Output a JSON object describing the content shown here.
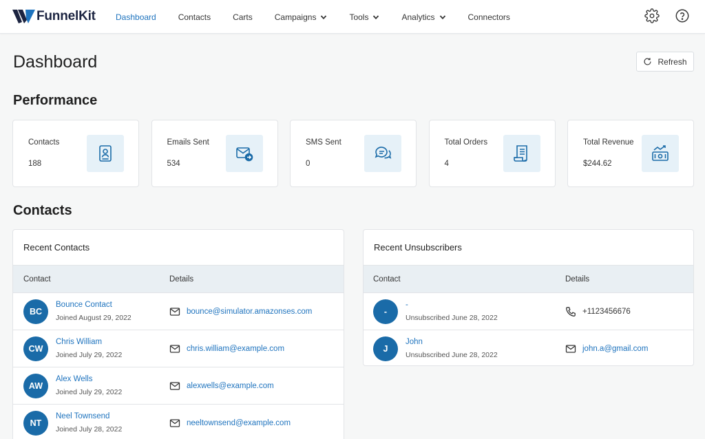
{
  "brand": {
    "name": "FunnelKit",
    "accent": "#1e73be"
  },
  "nav": {
    "items": [
      {
        "label": "Dashboard",
        "active": true,
        "dropdown": false
      },
      {
        "label": "Contacts",
        "active": false,
        "dropdown": false
      },
      {
        "label": "Carts",
        "active": false,
        "dropdown": false
      },
      {
        "label": "Campaigns",
        "active": false,
        "dropdown": true
      },
      {
        "label": "Tools",
        "active": false,
        "dropdown": true
      },
      {
        "label": "Analytics",
        "active": false,
        "dropdown": true
      },
      {
        "label": "Connectors",
        "active": false,
        "dropdown": false
      }
    ],
    "icons": [
      "gear-icon",
      "help-icon"
    ]
  },
  "page": {
    "title": "Dashboard",
    "refresh_label": "Refresh"
  },
  "performance": {
    "title": "Performance",
    "cards": [
      {
        "label": "Contacts",
        "value": "188",
        "icon": "contact-card-icon"
      },
      {
        "label": "Emails Sent",
        "value": "534",
        "icon": "email-sent-icon"
      },
      {
        "label": "SMS Sent",
        "value": "0",
        "icon": "chat-bubbles-icon"
      },
      {
        "label": "Total Orders",
        "value": "4",
        "icon": "receipt-icon"
      },
      {
        "label": "Total Revenue",
        "value": "$244.62",
        "icon": "revenue-icon"
      }
    ]
  },
  "contacts_section": {
    "title": "Contacts"
  },
  "recent_contacts": {
    "title": "Recent Contacts",
    "columns": [
      "Contact",
      "Details"
    ],
    "rows": [
      {
        "initials": "BC",
        "name": "Bounce Contact",
        "sub": "Joined August 29, 2022",
        "detail": "bounce@simulator.amazonses.com",
        "detail_type": "email"
      },
      {
        "initials": "CW",
        "name": "Chris William",
        "sub": "Joined July 29, 2022",
        "detail": "chris.william@example.com",
        "detail_type": "email"
      },
      {
        "initials": "AW",
        "name": "Alex Wells",
        "sub": "Joined July 29, 2022",
        "detail": "alexwells@example.com",
        "detail_type": "email"
      },
      {
        "initials": "NT",
        "name": "Neel Townsend",
        "sub": "Joined July 28, 2022",
        "detail": "neeltownsend@example.com",
        "detail_type": "email"
      }
    ]
  },
  "recent_unsubscribers": {
    "title": "Recent Unsubscribers",
    "columns": [
      "Contact",
      "Details"
    ],
    "rows": [
      {
        "initials": "-",
        "name": "-",
        "sub": "Unsubscribed June 28, 2022",
        "detail": "+1123456676",
        "detail_type": "phone"
      },
      {
        "initials": "J",
        "name": "John",
        "sub": "Unsubscribed June 28, 2022",
        "detail": "john.a@gmail.com",
        "detail_type": "email"
      }
    ]
  }
}
